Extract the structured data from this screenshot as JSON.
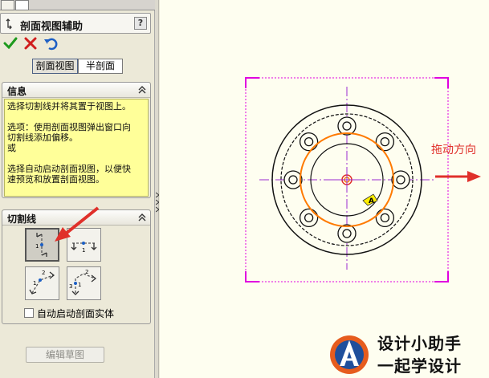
{
  "property_manager": {
    "title": "剖面视图辅助",
    "help_label": "?",
    "modes": {
      "section": "剖面视图",
      "half": "半剖面"
    },
    "info": {
      "header": "信息",
      "line1": "选择切割线并将其置于视图上。",
      "line2": "选项：使用剖面视图弹出窗口向\n切割线添加偏移。\n或",
      "line3": "选择自动启动剖面视图，以便快\n速预览和放置剖面视图。"
    },
    "cut_line": {
      "header": "切割线",
      "auto_start_label": "自动启动剖面实体",
      "auto_start_checked": false
    },
    "edit_sketch_label": "编辑草图"
  },
  "viewport": {
    "drag_label": "拖动方向",
    "cursor_label": "A",
    "colors": {
      "frame": "#e000e0",
      "orange": "#ff7a00",
      "arrow": "#e0302a",
      "center": "#9a2bd0"
    }
  },
  "watermark": {
    "line1": "设计小助手",
    "line2": "一起学设计"
  },
  "icons": [
    "section-view-icon",
    "check-icon",
    "cross-icon",
    "undo-icon",
    "chevron-up-icon",
    "vertical-cut-icon",
    "horizontal-cut-icon",
    "aligned-cut-icon",
    "auxiliary-cut-icon",
    "logo-icon"
  ]
}
